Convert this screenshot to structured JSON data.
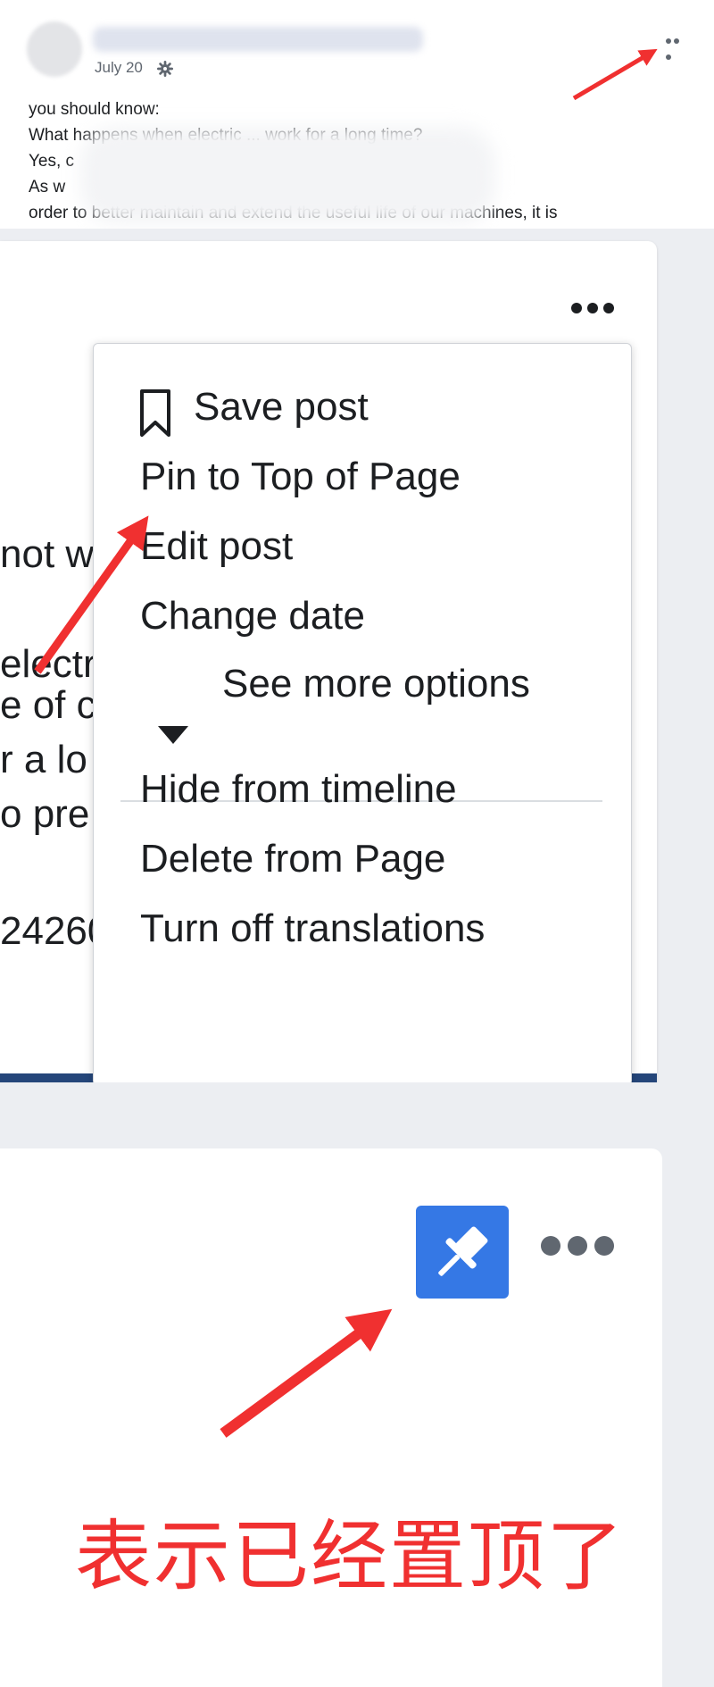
{
  "post_preview": {
    "date": "July 20",
    "lines": [
      "you should know:",
      "What happens when electric ... work for a long time?",
      "Yes, c",
      "As w                                                  ctronic product, so in",
      "order to better maintain and extend the useful life of our machines, it is"
    ]
  },
  "background_text": {
    "lines": [
      "not w",
      "electr",
      "e of c",
      "r a lo",
      "o pre",
      "",
      "24260"
    ]
  },
  "menu": {
    "save_post": "Save post",
    "pin_to_top": "Pin to Top of Page",
    "edit_post": "Edit post",
    "change_date": "Change date",
    "see_more": "See more options",
    "hide_from_timeline": "Hide from timeline",
    "delete_from_page": "Delete from Page",
    "turn_off_translations": "Turn off translations"
  },
  "annotation": {
    "text": "表示已经置顶了",
    "color": "#f03030"
  },
  "colors": {
    "pin_badge": "#3578e5",
    "arrow": "#f03030"
  },
  "icons": [
    "gear-icon",
    "more-options-icon",
    "bookmark-icon",
    "caret-down-icon",
    "pin-icon"
  ]
}
